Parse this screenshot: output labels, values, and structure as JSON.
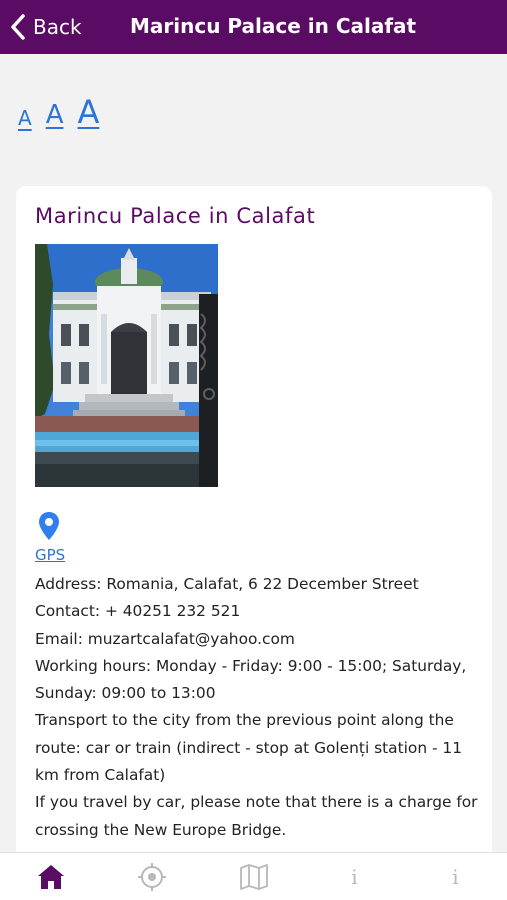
{
  "header": {
    "back_label": "Back",
    "title": "Marincu Palace in Calafat"
  },
  "font_size_controls": [
    {
      "label": "A",
      "size": "small"
    },
    {
      "label": "A",
      "size": "medium"
    },
    {
      "label": "A",
      "size": "large"
    }
  ],
  "card": {
    "title": "Marincu Palace in Calafat",
    "gps_label": "GPS",
    "info_lines": [
      "Address: Romania, Calafat, 6 22 December Street",
      "Contact: + 40251 232 521",
      "Email: muzartcalafat@yahoo.com",
      "Working hours: Monday - Friday: 9:00 - 15:00; Saturday, Sunday: 09:00 to 13:00",
      "Transport to the city from the previous point along the route: car or train (indirect - stop at Golenți station - 11 km from Calafat)",
      "If you travel by car, please note that there is a charge for crossing the New Europe Bridge."
    ]
  },
  "tabbar": {
    "tabs": [
      {
        "icon": "home-icon",
        "active": true
      },
      {
        "icon": "location-target-icon",
        "active": false
      },
      {
        "icon": "map-icon",
        "active": false
      },
      {
        "icon": "info-icon",
        "label": "i",
        "active": false
      },
      {
        "icon": "info-icon",
        "label": "i",
        "active": false
      }
    ]
  },
  "colors": {
    "brand_purple": "#5a0b63",
    "link_blue": "#2f73d6",
    "inactive_icon": "#b8b8b8"
  }
}
